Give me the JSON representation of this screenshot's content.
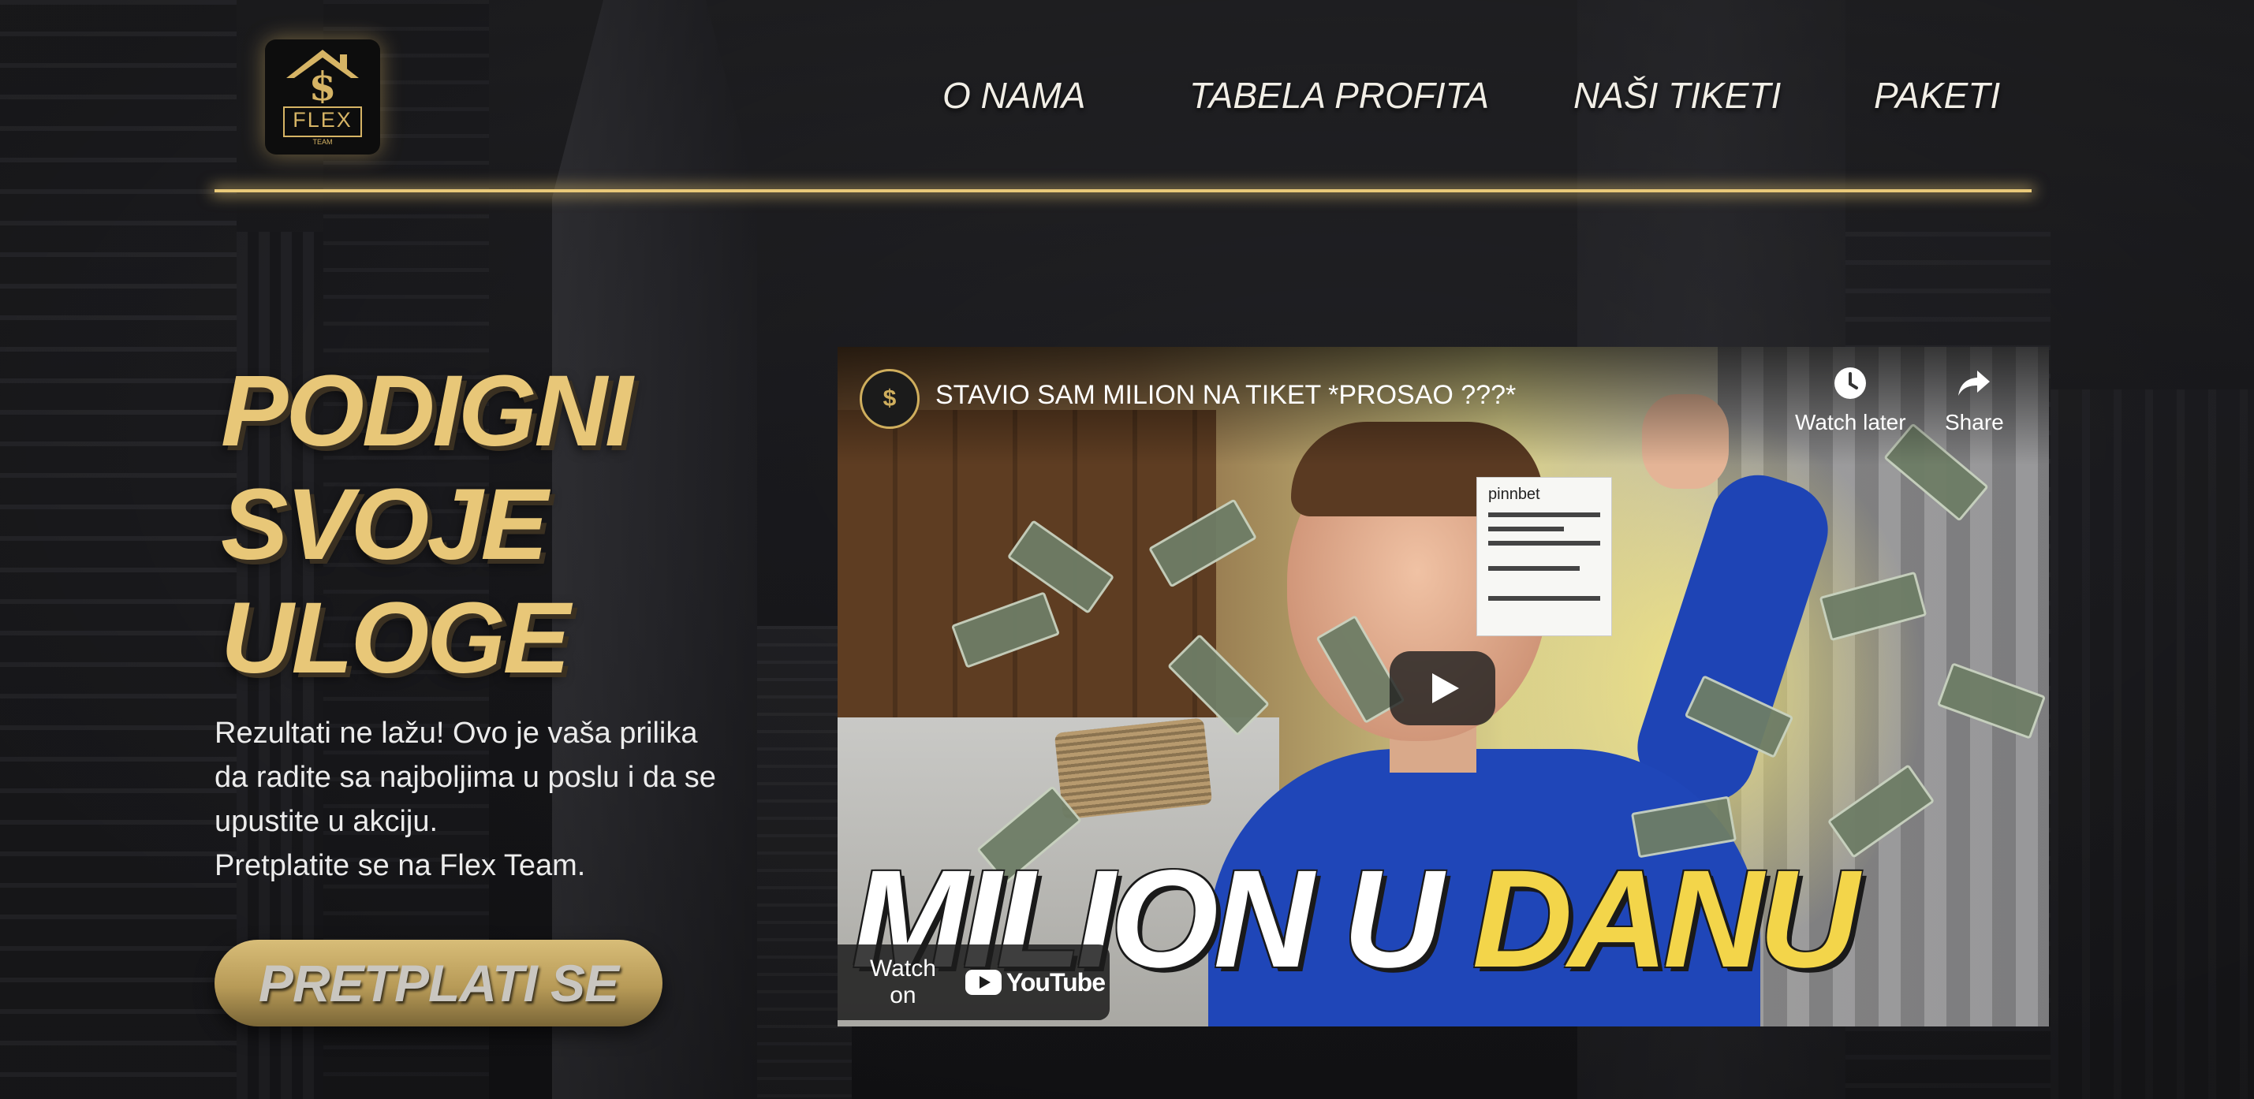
{
  "brand": {
    "logo_text": "FLEX",
    "logo_subtext": "TEAM",
    "logo_symbol": "$",
    "accent_color": "#e8c778"
  },
  "nav": {
    "items": [
      {
        "label": "O NAMA"
      },
      {
        "label": "TABELA PROFITA"
      },
      {
        "label": "NAŠI TIKETI"
      },
      {
        "label": "PAKETI"
      }
    ]
  },
  "hero": {
    "title_line1": "PODIGNI",
    "title_line2": "SVOJE",
    "title_line3": "ULOGE",
    "text_line1": "Rezultati ne lažu! Ovo je vaša prilika",
    "text_line2": "da radite sa najboljima u poslu i da se",
    "text_line3": "upustite u akciju.",
    "text_line4": "Pretplatite se na Flex Team.",
    "cta_label": "PRETPLATI SE"
  },
  "video": {
    "title": "STAVIO SAM MILION NA TIKET *PROSAO ???*",
    "watch_later_label": "Watch later",
    "share_label": "Share",
    "watch_on_label": "Watch on",
    "platform_label": "YouTube",
    "thumbnail_caption_white": "MILION U",
    "thumbnail_caption_yellow": "DANU",
    "ticket_brand": "pinnbet",
    "caption_highlight_color": "#f3d54a"
  }
}
